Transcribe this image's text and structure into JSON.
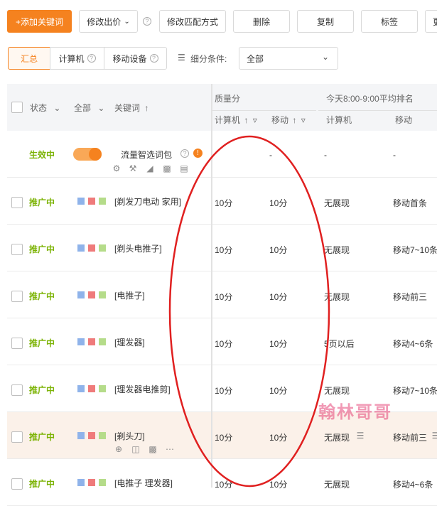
{
  "toolbar": {
    "add_keyword": "+添加关键词",
    "modify_bid": "修改出价",
    "modify_match": "修改匹配方式",
    "delete": "删除",
    "copy": "复制",
    "tag": "标签",
    "more_cut": "更"
  },
  "views": {
    "summary": "汇总",
    "computer": "计算机",
    "mobile": "移动设备",
    "filter_label": "细分条件:",
    "filter_value": "全部"
  },
  "table": {
    "headers": {
      "status": "状态",
      "all": "全部",
      "keyword": "关键词",
      "quality": "质量分",
      "quality_pc": "计算机",
      "quality_mobile": "移动",
      "rank_group": "今天8:00-9:00平均排名",
      "rank_pc": "计算机",
      "rank_mobile": "移动"
    },
    "pinned_row": {
      "status": "生效中",
      "keyword": "流量智选词包",
      "quality_pc": "",
      "quality_mobile": "-",
      "rank_pc": "-",
      "rank_mobile": "-"
    },
    "rows": [
      {
        "status": "推广中",
        "keyword": "[剃发刀电动 家用]",
        "quality_pc": "10分",
        "quality_mobile": "10分",
        "rank_pc": "无展现",
        "rank_mobile": "移动首条"
      },
      {
        "status": "推广中",
        "keyword": "[剃头电推子]",
        "quality_pc": "10分",
        "quality_mobile": "10分",
        "rank_pc": "无展现",
        "rank_mobile": "移动7~10条"
      },
      {
        "status": "推广中",
        "keyword": "[电推子]",
        "quality_pc": "10分",
        "quality_mobile": "10分",
        "rank_pc": "无展现",
        "rank_mobile": "移动前三"
      },
      {
        "status": "推广中",
        "keyword": "[理发器]",
        "quality_pc": "10分",
        "quality_mobile": "10分",
        "rank_pc": "5页以后",
        "rank_mobile": "移动4~6条"
      },
      {
        "status": "推广中",
        "keyword": "[理发器电推剪]",
        "quality_pc": "10分",
        "quality_mobile": "10分",
        "rank_pc": "无展现",
        "rank_mobile": "移动7~10条"
      },
      {
        "status": "推广中",
        "keyword": "[剃头刀]",
        "quality_pc": "10分",
        "quality_mobile": "10分",
        "rank_pc": "无展现",
        "rank_mobile": "移动前三"
      },
      {
        "status": "推广中",
        "keyword": "[电推子 理发器]",
        "quality_pc": "10分",
        "quality_mobile": "10分",
        "rank_pc": "无展现",
        "rank_mobile": "移动4~6条"
      }
    ]
  },
  "watermark": "翰林哥哥",
  "colors": {
    "accent": "#f5821f",
    "status_green": "#7cb305",
    "annotation_red": "#e02020"
  }
}
